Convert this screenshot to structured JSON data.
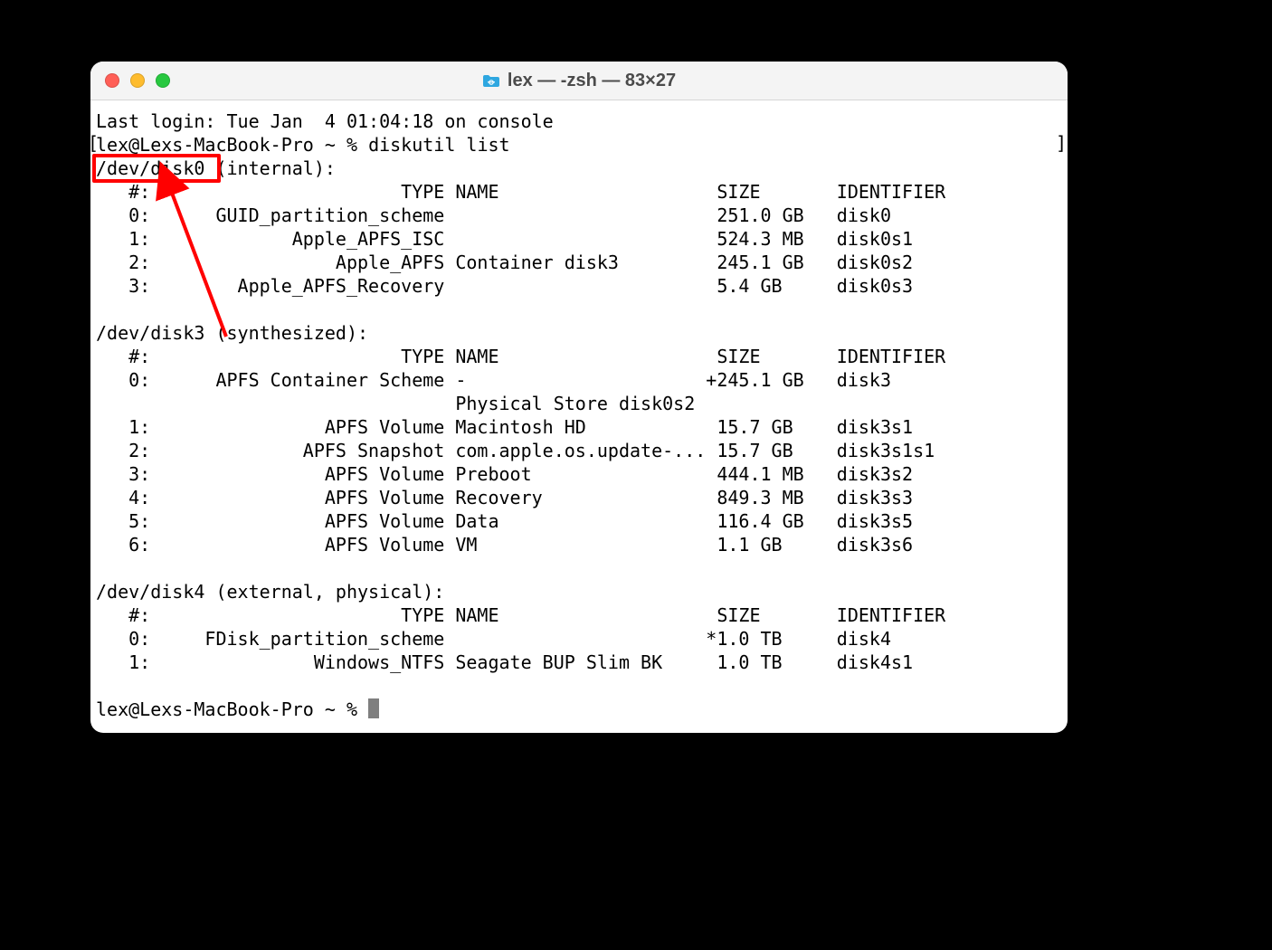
{
  "window": {
    "title": "lex — -zsh — 83×27"
  },
  "annotation": {
    "highlight_target": "/dev/disk0"
  },
  "terminal": {
    "last_login": "Last login: Tue Jan  4 01:04:18 on console",
    "prompt_host": "lex@Lexs-MacBook-Pro",
    "prompt_path": "~",
    "prompt_symbol": "%",
    "command": "diskutil list",
    "disks": [
      {
        "header": "/dev/disk0 (internal):",
        "col_header": "   #:                       TYPE NAME                    SIZE       IDENTIFIER",
        "rows": [
          "   0:      GUID_partition_scheme                         251.0 GB   disk0",
          "   1:             Apple_APFS_ISC                         524.3 MB   disk0s1",
          "   2:                 Apple_APFS Container disk3         245.1 GB   disk0s2",
          "   3:        Apple_APFS_Recovery                         5.4 GB     disk0s3"
        ]
      },
      {
        "header": "/dev/disk3 (synthesized):",
        "col_header": "   #:                       TYPE NAME                    SIZE       IDENTIFIER",
        "rows": [
          "   0:      APFS Container Scheme -                      +245.1 GB   disk3",
          "                                 Physical Store disk0s2",
          "   1:                APFS Volume Macintosh HD            15.7 GB    disk3s1",
          "   2:              APFS Snapshot com.apple.os.update-... 15.7 GB    disk3s1s1",
          "   3:                APFS Volume Preboot                 444.1 MB   disk3s2",
          "   4:                APFS Volume Recovery                849.3 MB   disk3s3",
          "   5:                APFS Volume Data                    116.4 GB   disk3s5",
          "   6:                APFS Volume VM                      1.1 GB     disk3s6"
        ]
      },
      {
        "header": "/dev/disk4 (external, physical):",
        "col_header": "   #:                       TYPE NAME                    SIZE       IDENTIFIER",
        "rows": [
          "   0:     FDisk_partition_scheme                        *1.0 TB     disk4",
          "   1:               Windows_NTFS Seagate BUP Slim BK     1.0 TB     disk4s1"
        ]
      }
    ],
    "final_prompt": "lex@Lexs-MacBook-Pro ~ % "
  }
}
